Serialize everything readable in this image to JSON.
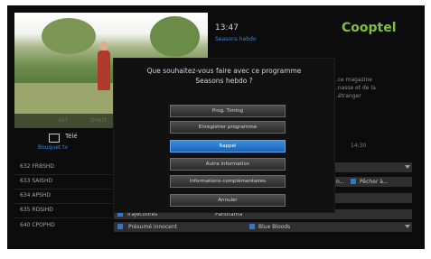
{
  "header": {
    "time": "13:47",
    "program": "Seasons hebdo",
    "logo": "Cooptel",
    "description": "...ce magazine\n...nasse et de la\n...étranger"
  },
  "preview": {
    "subtitle_left": "167",
    "subtitle_right": "Direct"
  },
  "tv_tab": {
    "label": "Télé",
    "sub": "Bouquet tv"
  },
  "channels": [
    "632 FRBSHD",
    "633 SAISHD",
    "634 APSHD",
    "635 RDSIHD",
    "640 CPOPHD"
  ],
  "grid": {
    "time": "14:30",
    "rows": [
      {
        "left": "",
        "right": ""
      },
      {
        "left": "n...",
        "right": "Pêcher à..."
      },
      {
        "left": "",
        "right": ""
      },
      {
        "left": "Trajectoires",
        "right": "Panorama"
      },
      {
        "left": "Présumé innocent",
        "right": "Blue Bloods"
      }
    ]
  },
  "dialog": {
    "question": "Que souhaitez-vous faire avec ce programme\nSeasons hebdo ?",
    "buttons": [
      "Prog. Timing",
      "Enregistrer programme",
      "Rappel",
      "Autre information",
      "Informations complémentaires",
      "Annuler"
    ],
    "selected_index": 2
  },
  "colors": {
    "accent": "#3e86c9",
    "selected": "#2a7bd0",
    "logo": "#7fbf3b",
    "background": "#0c0c0c"
  }
}
